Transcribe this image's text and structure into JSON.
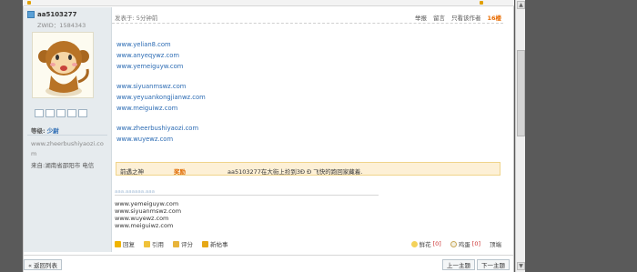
{
  "user": {
    "name": "aa5103277",
    "zwid": "ZWID：1584343",
    "rank_label": "等级:",
    "rank_value": "少尉",
    "site": "www.zheerbushiyaozi.com",
    "location": "来自:湖南省邵阳市 电信"
  },
  "post": {
    "posted_time": "发表于: 5分钟前",
    "header_actions": {
      "report": "举报",
      "message": "留言",
      "only_author": "只看该作者",
      "floor": "16楼"
    },
    "links": [
      "www.yelian8.com",
      "www.anyeqywz.com",
      "www.yemeiguyw.com",
      "www.siyuanmswz.com",
      "www.yeyuankongjianwz.com",
      "www.meiguiwz.com",
      "www.zheerbushiyaozi.com",
      "www.wuyewz.com"
    ],
    "award": {
      "title": "前遇之神",
      "type": "奖励",
      "text": "aa5103277在大街上捡到3Ð Ð   飞快的跑回家藏着."
    },
    "signature_header": "aaa.aaaaaa.aaa",
    "signature": [
      "www.yemeiguyw.com",
      "www.siyuanmswz.com",
      "www.wuyewz.com",
      "www.meiguiwz.com"
    ],
    "footer": {
      "reply": "回复",
      "quote": "引用",
      "rate": "评分",
      "new_thread": "新帖事",
      "flower": "鲜花",
      "flower_count": "[0]",
      "egg": "鸡蛋",
      "egg_count": "[0]",
      "hug": "顶端"
    }
  },
  "nav": {
    "back": "« 返回列表",
    "prev": "上一主题",
    "next": "下一主题"
  },
  "colors": {
    "link": "#2a6ab3",
    "floor": "#e86b00",
    "award_bg": "#fdf0d6",
    "sidebar_bg": "#e6ebee"
  }
}
